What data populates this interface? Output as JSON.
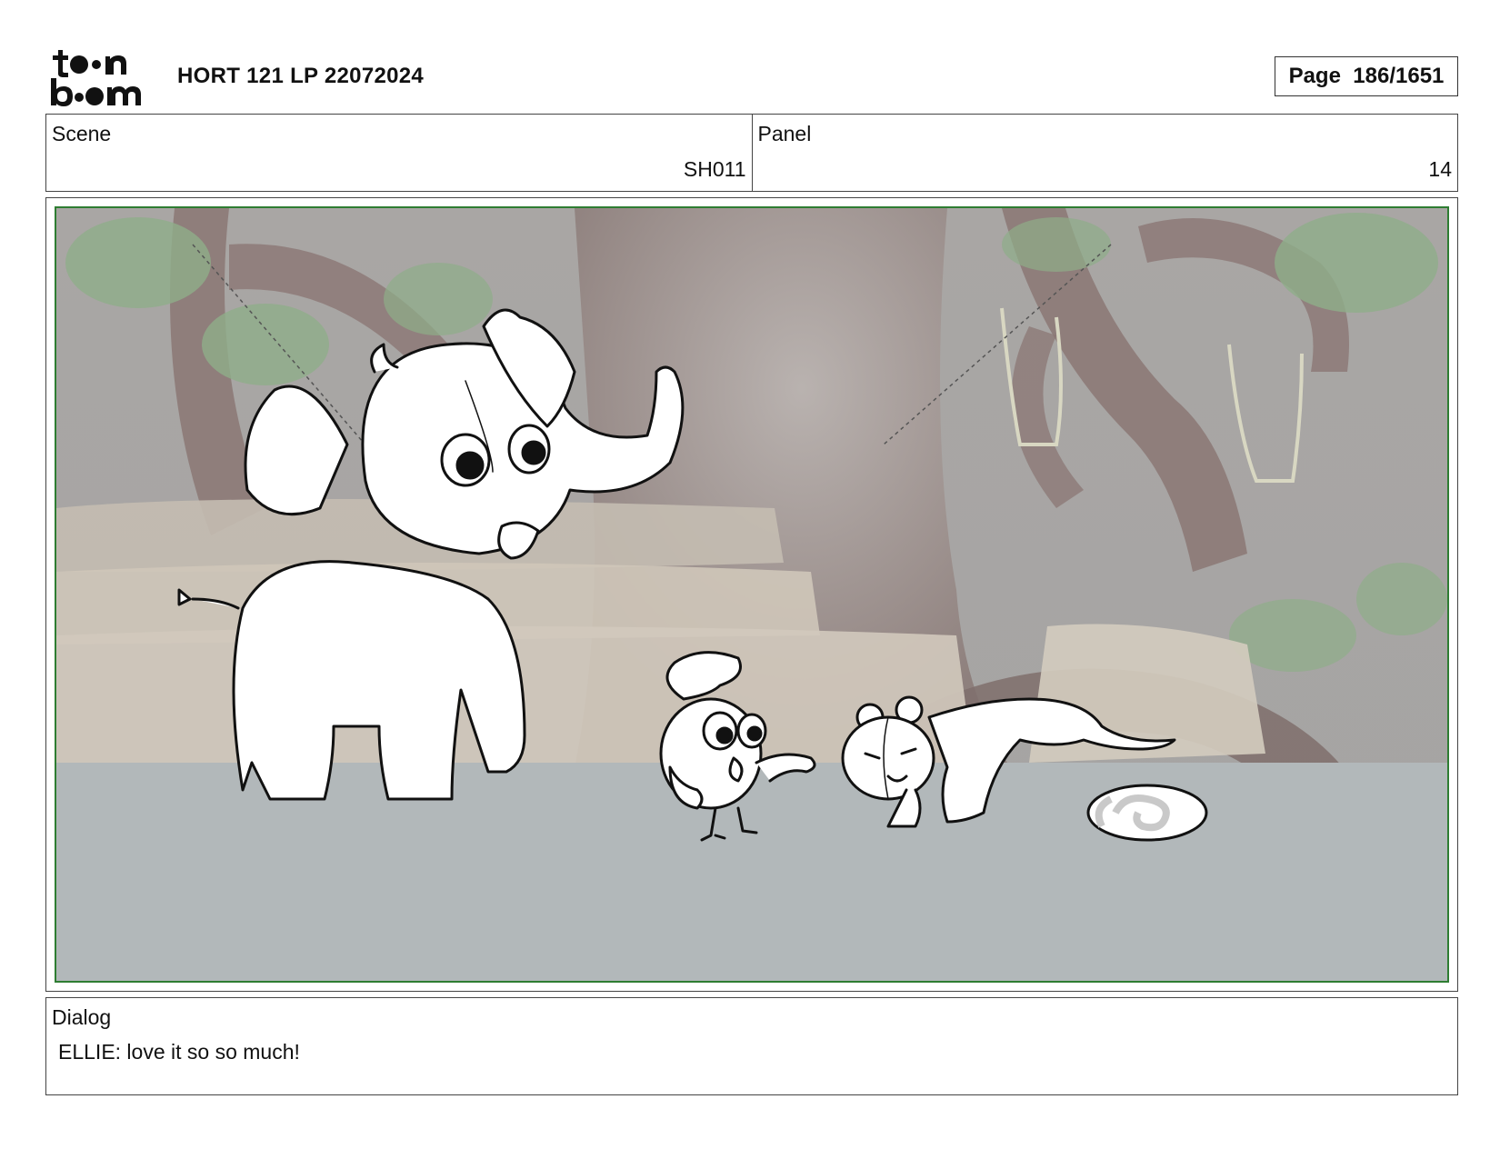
{
  "header": {
    "logo_text": "toonboom",
    "title": "HORT 121 LP 22072024",
    "page_label": "Page",
    "page_number": "186/1651"
  },
  "scene": {
    "label": "Scene",
    "value": "SH011"
  },
  "panel": {
    "label": "Panel",
    "value": "14"
  },
  "dialog": {
    "label": "Dialog",
    "text": "ELLIE: love it so so much!"
  },
  "colors": {
    "panel_border": "#2e7d32",
    "ground": "#b2b8ba",
    "tree": "#8d7b78",
    "rocks": "#cdc3b5",
    "foliage": "#8fae89"
  },
  "icons": [
    "toonboom-logo"
  ]
}
